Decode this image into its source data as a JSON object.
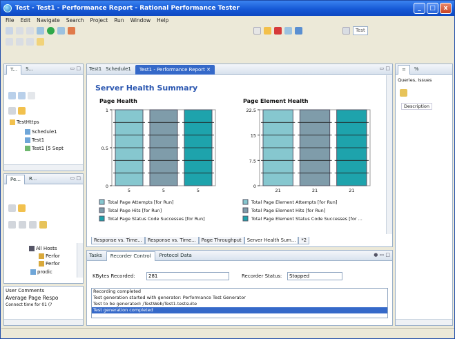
{
  "window": {
    "title": "Test - Test1 - Performance Report - Rational Performance Tester",
    "buttons": [
      "_",
      "□",
      "x"
    ]
  },
  "menubar": [
    "File",
    "Edit",
    "Navigate",
    "Search",
    "Project",
    "Run",
    "Window",
    "Help"
  ],
  "toolbar": {
    "perspective_label": "Test"
  },
  "left_top_panel": {
    "tabs": [
      "T...",
      "S..."
    ],
    "tree": [
      "TestHttps",
      "Schedule1",
      "Test1",
      "Test1 [5 Sept"
    ]
  },
  "left_mid_panel": {
    "tabs": [
      "Pe...",
      "R..."
    ],
    "tree": [
      "All Hosts",
      "Perfor",
      "Perfor",
      "prodic"
    ]
  },
  "left_bottom_panel": {
    "rows": [
      "User Comments",
      "Average Page Respo",
      "Connect time for 01 (?"
    ]
  },
  "editor": {
    "tabs": [
      "Test1",
      "Schedule1",
      "Test1 - Performance Report"
    ],
    "heading": "Server Health Summary",
    "bottom_tabs": [
      "Response vs. Time...",
      "Response vs. Time...",
      "Page Throughput",
      "Server Health Sum...",
      "*2"
    ]
  },
  "chart_data": [
    {
      "type": "bar",
      "title": "Page Health",
      "categories": [
        "5",
        "5",
        "5"
      ],
      "values": [
        5,
        5,
        5
      ],
      "yticks": [
        "1",
        "0.5",
        "0"
      ],
      "ylim": [
        0,
        1
      ],
      "colors": [
        "#86c7cf",
        "#7f9caa",
        "#1ea3ac"
      ],
      "legend": [
        "Total Page Attempts [for Run]",
        "Total Page Hits [for Run]",
        "Total Page Status Code Successes [for Run]"
      ]
    },
    {
      "type": "bar",
      "title": "Page Element Health",
      "categories": [
        "21",
        "21",
        "21"
      ],
      "values": [
        21,
        21,
        21
      ],
      "yticks": [
        "22.5",
        "15",
        "7.5",
        "0"
      ],
      "ylim": [
        0,
        22.5
      ],
      "colors": [
        "#86c7cf",
        "#7f9caa",
        "#1ea3ac"
      ],
      "legend": [
        "Total Page Element Attempts [for Run]",
        "Total Page Element Hits [for Run]",
        "Total Page Element Status Code Successes [for ..."
      ]
    }
  ],
  "right_panel": {
    "tabs": [
      "=",
      "%"
    ],
    "title": "Queries, Issues",
    "column": "Description"
  },
  "recorder": {
    "tabs": [
      "Tasks",
      "Recorder Control",
      "Protocol Data"
    ],
    "kbytes_label": "KBytes Recorded:",
    "kbytes_value": "281",
    "status_label": "Recorder Status:",
    "status_value": "Stopped",
    "log": [
      "Recording completed",
      "Test generation started with generator: Performance Test Generator",
      "Test to be generated: /TestWeb/Test1.testsuite",
      "Test generation completed"
    ]
  }
}
